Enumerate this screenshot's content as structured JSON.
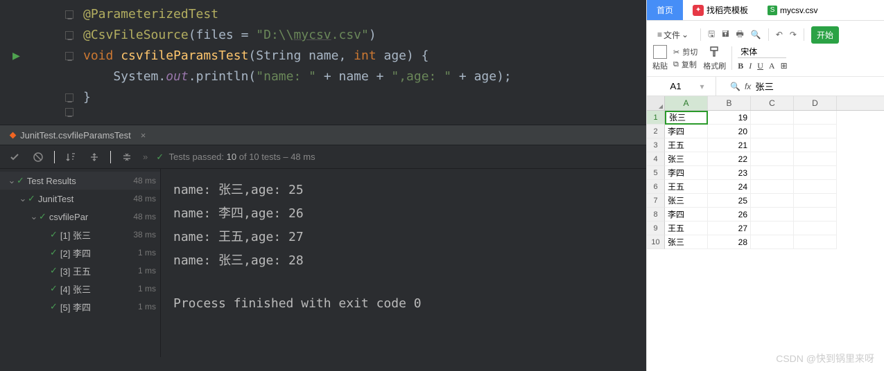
{
  "code": {
    "l1a": "@ParameterizedTest",
    "l2a": "@CsvFileSource",
    "l2b": "(files = ",
    "l2c": "\"D:\\\\",
    "l2d": "mycsv",
    "l2e": ".csv\"",
    "l2f": ")",
    "l3a": "void ",
    "l3b": "csvfileParamsTest",
    "l3c": "(String name, ",
    "l3d": "int ",
    "l3e": "age) {",
    "l4a": "    System.",
    "l4b": "out",
    "l4c": ".println(",
    "l4d": "\"name: \"",
    "l4e": " + name + ",
    "l4f": "\",age: \"",
    "l4g": " + age);",
    "l5a": "}"
  },
  "tab": {
    "label": "JunitTest.csvfileParamsTest",
    "close": "×"
  },
  "toolbar": {
    "check": "✓",
    "passedPrefix": "Tests passed:",
    "passedCount": "10",
    "passedOf": "of 10 tests",
    "time": "– 48 ms",
    "chev": "»"
  },
  "tree": {
    "root": {
      "label": "Test Results",
      "time": "48 ms"
    },
    "n1": {
      "label": "JunitTest",
      "time": "48 ms"
    },
    "n2": {
      "label": "csvfilePar",
      "time": "48 ms"
    },
    "leaves": [
      {
        "label": "[1] 张三",
        "time": "38 ms"
      },
      {
        "label": "[2] 李四",
        "time": "1 ms"
      },
      {
        "label": "[3] 王五",
        "time": "1 ms"
      },
      {
        "label": "[4] 张三",
        "time": "1 ms"
      },
      {
        "label": "[5] 李四",
        "time": "1 ms"
      }
    ]
  },
  "console": {
    "l1": "name: 张三,age: 25",
    "l2": "name: 李四,age: 26",
    "l3": "name: 王五,age: 27",
    "l4": "name: 张三,age: 28",
    "l5": "Process finished with exit code 0"
  },
  "ss": {
    "tabs": {
      "home": "首页",
      "tpl": "找稻壳模板",
      "file": "mycsv.csv"
    },
    "menu": {
      "file": "文件",
      "start": "开始"
    },
    "clip": {
      "paste": "粘贴",
      "cut": "剪切",
      "copy": "复制",
      "fmt": "格式刷"
    },
    "font": {
      "name": "宋体"
    },
    "cellRef": "A1",
    "cellVal": "张三",
    "cols": [
      "A",
      "B",
      "C",
      "D"
    ],
    "rows": [
      {
        "n": "1",
        "a": "张三",
        "b": "19"
      },
      {
        "n": "2",
        "a": "李四",
        "b": "20"
      },
      {
        "n": "3",
        "a": "王五",
        "b": "21"
      },
      {
        "n": "4",
        "a": "张三",
        "b": "22"
      },
      {
        "n": "5",
        "a": "李四",
        "b": "23"
      },
      {
        "n": "6",
        "a": "王五",
        "b": "24"
      },
      {
        "n": "7",
        "a": "张三",
        "b": "25"
      },
      {
        "n": "8",
        "a": "李四",
        "b": "26"
      },
      {
        "n": "9",
        "a": "王五",
        "b": "27"
      },
      {
        "n": "10",
        "a": "张三",
        "b": "28"
      }
    ]
  },
  "watermark": "CSDN @快到锅里来呀"
}
